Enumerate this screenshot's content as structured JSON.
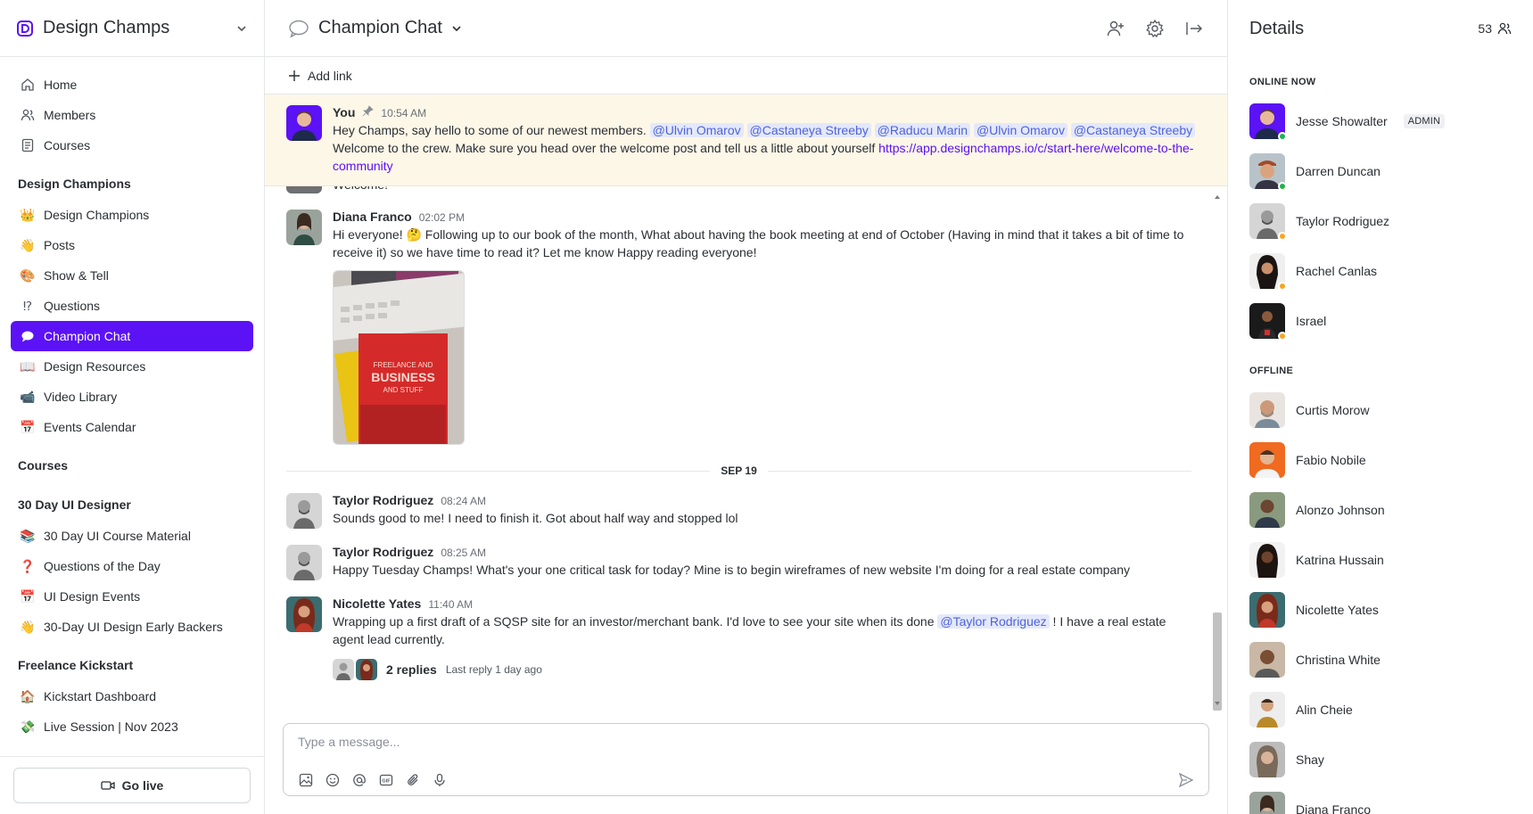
{
  "colors": {
    "accent": "#5b12f5",
    "online": "#22b14c",
    "away": "#f5a623"
  },
  "sidebar": {
    "brand": "Design Champs",
    "primary": [
      {
        "label": "Home",
        "icon": "home-icon"
      },
      {
        "label": "Members",
        "icon": "members-icon"
      },
      {
        "label": "Courses",
        "icon": "courses-icon"
      }
    ],
    "groups": [
      {
        "heading": "Design Champions",
        "items": [
          {
            "label": "Design Champions",
            "emoji": "👑"
          },
          {
            "label": "Posts",
            "emoji": "👋"
          },
          {
            "label": "Show & Tell",
            "emoji": "🎨"
          },
          {
            "label": "Questions",
            "emoji": "⁉"
          },
          {
            "label": "Champion Chat",
            "emoji": "💬",
            "active": true
          },
          {
            "label": "Design Resources",
            "emoji": "📖"
          },
          {
            "label": "Video Library",
            "emoji": "📹"
          },
          {
            "label": "Events Calendar",
            "emoji": "📅"
          }
        ]
      },
      {
        "heading": "Courses",
        "items": []
      },
      {
        "heading": "30 Day UI Designer",
        "items": [
          {
            "label": "30 Day UI Course Material",
            "emoji": "📚"
          },
          {
            "label": "Questions of the Day",
            "emoji": "❓"
          },
          {
            "label": "UI Design Events",
            "emoji": "📅"
          },
          {
            "label": "30-Day UI Design Early Backers",
            "emoji": "👋"
          }
        ]
      },
      {
        "heading": "Freelance Kickstart",
        "items": [
          {
            "label": "Kickstart Dashboard",
            "emoji": "🏠"
          },
          {
            "label": "Live Session | Nov 2023",
            "emoji": "💸"
          }
        ]
      }
    ],
    "go_live": "Go live"
  },
  "header": {
    "title": "Champion Chat",
    "add_link": "Add link"
  },
  "pinned": {
    "author": "You",
    "time": "10:54 AM",
    "text_before": "Hey Champs, say hello to some of our newest members. ",
    "mentions": [
      "@Ulvin Omarov",
      "@Castaneya Streeby",
      "@Raducu Marin",
      "@Ulvin Omarov",
      "@Castaneya Streeby"
    ],
    "text_after": " Welcome to the crew. Make sure you head over the welcome post and tell us a little about yourself ",
    "link": "https://app.designchamps.io/c/start-here/welcome-to-the-community"
  },
  "cut_text": "Welcome!",
  "messages": [
    {
      "author": "Diana Franco",
      "time": "02:02 PM",
      "text": "Hi everyone!  🤔 Following up to our book of the month, What about having the book meeting at end of October (Having in mind that it takes a bit of time to receive it) so we have time to read it? Let me know Happy reading everyone!"
    },
    {
      "author": "Taylor Rodriguez",
      "time": "08:24 AM",
      "text": "Sounds good to me! I need to finish it. Got about half way and stopped lol"
    },
    {
      "author": "Taylor Rodriguez",
      "time": "08:25 AM",
      "text": "Happy Tuesday Champs! What's your one critical task for today? Mine is to begin wireframes of new website I'm doing for a real estate company"
    },
    {
      "author": "Nicolette Yates",
      "time": "11:40 AM",
      "text_before": "Wrapping up a first draft of a SQSP site for an investor/merchant bank.  I'd love to see your site when its done ",
      "mention": "@Taylor Rodriguez",
      "text_after": " ! I have a real estate agent lead currently.",
      "replies": "2 replies",
      "last_reply": "Last reply 1 day ago"
    }
  ],
  "date_divider": "SEP 19",
  "composer": {
    "placeholder": "Type a message..."
  },
  "details": {
    "title": "Details",
    "count": "53",
    "online_label": "ONLINE NOW",
    "offline_label": "OFFLINE",
    "admin_badge": "ADMIN",
    "online": [
      {
        "name": "Jesse Showalter",
        "status": "online",
        "admin": true
      },
      {
        "name": "Darren Duncan",
        "status": "online"
      },
      {
        "name": "Taylor Rodriguez",
        "status": "away"
      },
      {
        "name": "Rachel Canlas",
        "status": "away"
      },
      {
        "name": "Israel",
        "status": "away"
      }
    ],
    "offline": [
      "Curtis Morow",
      "Fabio Nobile",
      "Alonzo Johnson",
      "Katrina Hussain",
      "Nicolette Yates",
      "Christina White",
      "Alin Cheie",
      "Shay",
      "Diana Franco"
    ]
  }
}
